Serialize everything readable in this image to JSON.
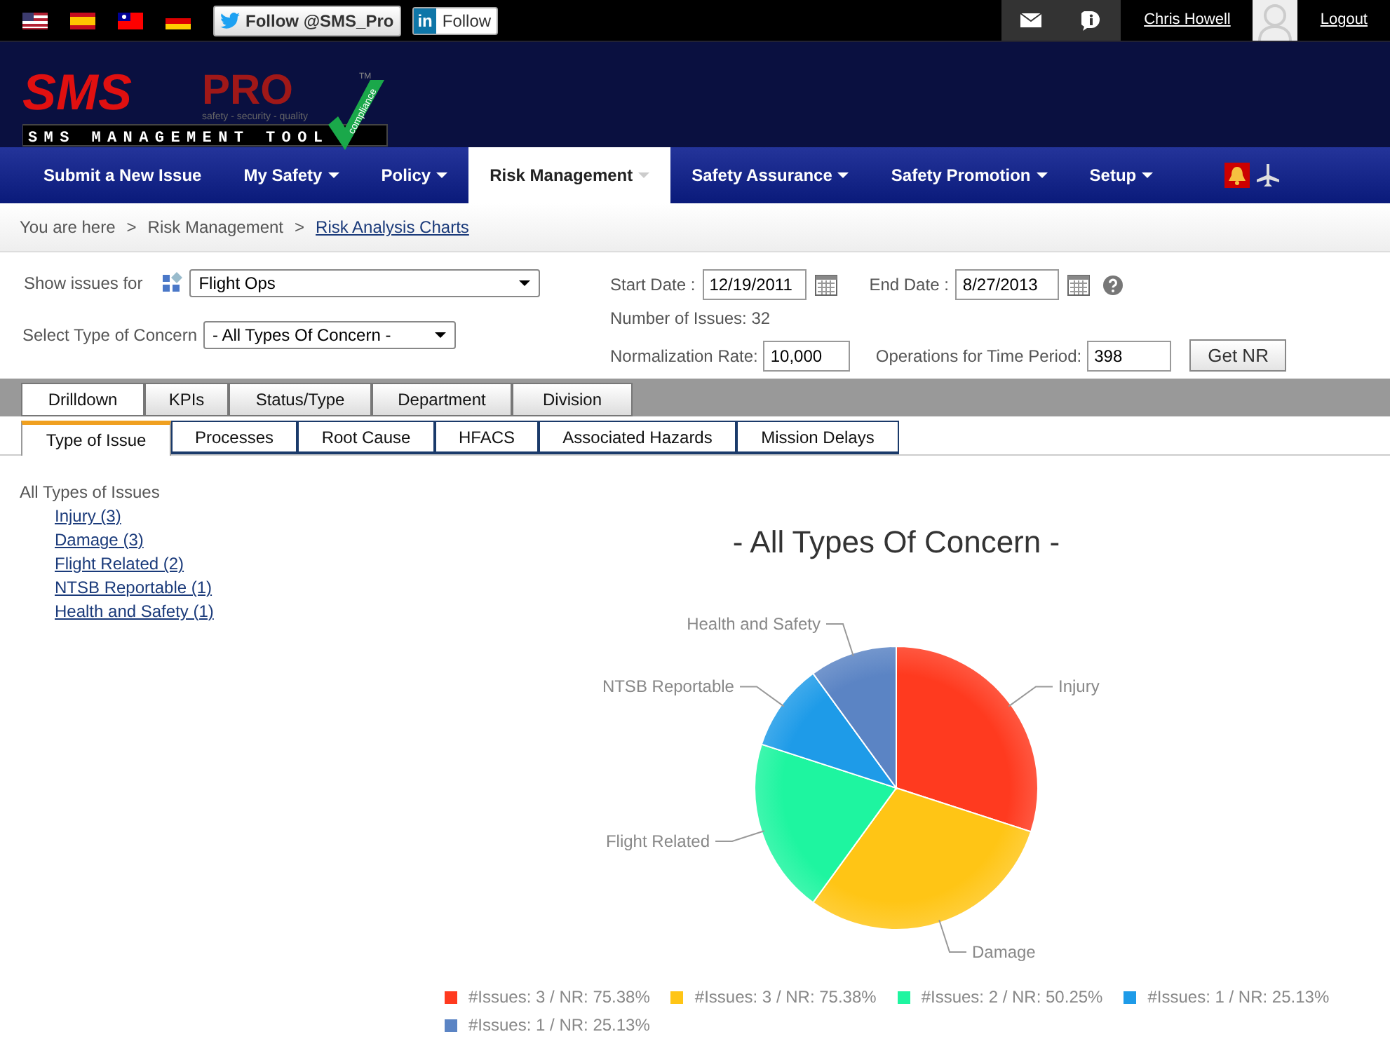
{
  "top_bar": {
    "twitter_button": "Follow @SMS_Pro",
    "linkedin_logo": "in",
    "linkedin_button": "Follow",
    "user_name": "Chris Howell",
    "logout": "Logout"
  },
  "logo": {
    "brand": "SMS",
    "brand_suffix": "PRO",
    "trademark": "TM",
    "tagline": "safety - security - quality",
    "subtitle": "SMS MANAGEMENT TOOL",
    "badge": "compliance"
  },
  "nav": [
    {
      "label": "Submit a New Issue",
      "dropdown": false,
      "selected": false
    },
    {
      "label": "My Safety",
      "dropdown": true,
      "selected": false
    },
    {
      "label": "Policy",
      "dropdown": true,
      "selected": false
    },
    {
      "label": "Risk Management",
      "dropdown": true,
      "selected": true
    },
    {
      "label": "Safety Assurance",
      "dropdown": true,
      "selected": false
    },
    {
      "label": "Safety Promotion",
      "dropdown": true,
      "selected": false
    },
    {
      "label": "Setup",
      "dropdown": true,
      "selected": false
    }
  ],
  "breadcrumb": {
    "prefix": "You are here",
    "items": [
      {
        "label": "Risk Management",
        "link": false
      },
      {
        "label": "Risk Analysis Charts",
        "link": true
      }
    ],
    "separator": ">"
  },
  "filters": {
    "show_issues_label": "Show issues for",
    "show_issues_value": "Flight Ops",
    "concern_label": "Select Type of Concern",
    "concern_value": "- All Types Of Concern -",
    "start_label": "Start Date :",
    "start_value": "12/19/2011",
    "end_label": "End Date :",
    "end_value": "8/27/2013",
    "issues_count": "Number of Issues: 32",
    "norm_label": "Normalization Rate:",
    "norm_value": "10,000",
    "ops_label": "Operations for Time Period:",
    "ops_value": "398",
    "get_nr": "Get NR"
  },
  "tabs": [
    {
      "label": "Drilldown",
      "selected": true
    },
    {
      "label": "KPIs",
      "selected": false
    },
    {
      "label": "Status/Type",
      "selected": false
    },
    {
      "label": "Department",
      "selected": false
    },
    {
      "label": "Division",
      "selected": false
    }
  ],
  "subtabs": [
    {
      "label": "Type of Issue",
      "selected": true
    },
    {
      "label": "Processes",
      "selected": false
    },
    {
      "label": "Root Cause",
      "selected": false
    },
    {
      "label": "HFACS",
      "selected": false
    },
    {
      "label": "Associated Hazards",
      "selected": false
    },
    {
      "label": "Mission Delays",
      "selected": false
    }
  ],
  "tree": {
    "label": "All Types of Issues",
    "children": [
      {
        "label": "Injury (3)"
      },
      {
        "label": "Damage (3)"
      },
      {
        "label": "Flight Related (2)"
      },
      {
        "label": "NTSB Reportable (1)"
      },
      {
        "label": "Health and Safety (1)"
      }
    ]
  },
  "chart": {
    "chart_data": {
      "type": "pie",
      "title": "- All Types Of Concern -",
      "categories": [
        "Injury",
        "Damage",
        "Flight Related",
        "NTSB Reportable",
        "Health and Safety"
      ],
      "values": [
        30,
        30,
        20,
        10,
        10
      ]
    },
    "legend": [
      {
        "label": "#Issues: 3 / NR: 75.38%",
        "color": "#ff3a1f"
      },
      {
        "label": "#Issues: 3 / NR: 75.38%",
        "color": "#ffc515"
      },
      {
        "label": "#Issues: 2 / NR: 50.25%",
        "color": "#1ef5a0"
      },
      {
        "label": "#Issues: 1 / NR: 25.13%",
        "color": "#1e9be8"
      },
      {
        "label": "#Issues: 1 / NR: 25.13%",
        "color": "#5b84c4"
      }
    ]
  }
}
